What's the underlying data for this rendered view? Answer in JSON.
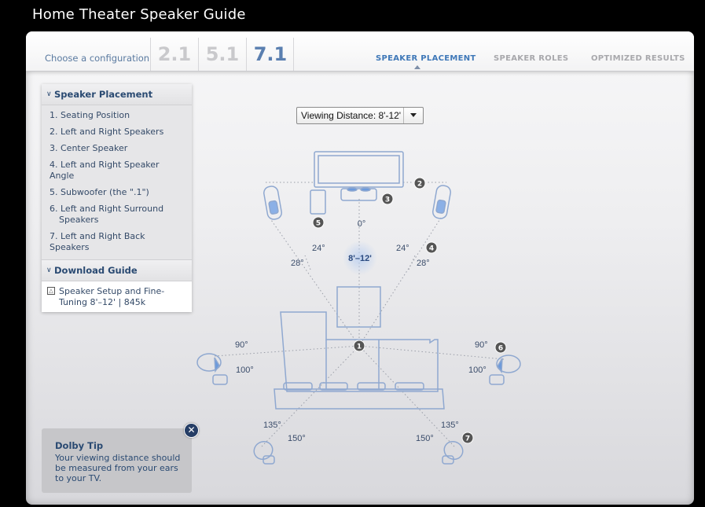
{
  "app": {
    "title": "Home Theater Speaker Guide"
  },
  "config": {
    "label": "Choose a configuration",
    "options": [
      {
        "label": "2.1",
        "active": false
      },
      {
        "label": "5.1",
        "active": false
      },
      {
        "label": "7.1",
        "active": true
      }
    ]
  },
  "steps": [
    {
      "label": "SPEAKER PLACEMENT",
      "active": true
    },
    {
      "label": "SPEAKER ROLES",
      "active": false
    },
    {
      "label": "OPTIMIZED RESULTS",
      "active": false
    }
  ],
  "sidebar": {
    "placement": {
      "heading": "Speaker Placement",
      "items": [
        {
          "label": "1. Seating Position"
        },
        {
          "label": "2. Left and Right Speakers"
        },
        {
          "label": "3. Center Speaker"
        },
        {
          "label": "4. Left and Right Speaker Angle"
        },
        {
          "label": "5. Subwoofer (the \".1\")"
        },
        {
          "label": "6. Left and Right Surround Speakers"
        },
        {
          "label": "7. Left and Right Back Speakers"
        }
      ]
    },
    "download": {
      "heading": "Download Guide",
      "file_label": "Speaker Setup and Fine-Tuning 8'–12' | 845k",
      "icon": "pdf-icon"
    }
  },
  "tip": {
    "title": "Dolby Tip",
    "body": "Your viewing distance should be measured from your ears to your TV.",
    "close_icon": "close-icon"
  },
  "viewing_distance": {
    "selected": "Viewing Distance: 8'-12'"
  },
  "diagram": {
    "distance_label": "8'–12'",
    "angles": {
      "center": "0°",
      "front_inner_left": "24°",
      "front_outer_left": "28°",
      "front_inner_right": "24°",
      "front_outer_right": "28°",
      "surround_left_upper": "90°",
      "surround_left_lower": "100°",
      "surround_right_upper": "90°",
      "surround_right_lower": "100°",
      "back_left_upper": "135°",
      "back_left_lower": "150°",
      "back_right_upper": "135°",
      "back_right_lower": "150°"
    },
    "badges": [
      "1",
      "2",
      "3",
      "4",
      "5",
      "6",
      "7"
    ]
  },
  "colors": {
    "accent": "#3f78b8",
    "heading": "#2a4a72",
    "inactive_tab": "#a8a8ac",
    "line_art": "#8fa8d0"
  }
}
